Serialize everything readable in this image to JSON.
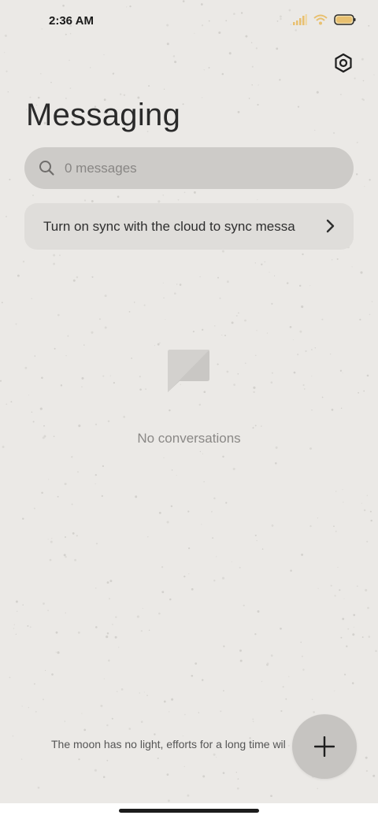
{
  "status_bar": {
    "time": "2:36 AM",
    "icons": [
      "signal-icon",
      "wifi-icon",
      "battery-icon"
    ],
    "signal_color": "#e8c070",
    "wifi_color": "#e8c070",
    "battery_color": "#e8c070"
  },
  "header": {
    "title": "Messaging",
    "settings_icon": "settings-icon"
  },
  "search": {
    "icon": "search-icon",
    "placeholder": "0 messages"
  },
  "sync_banner": {
    "text": "Turn on sync with the cloud to sync messa",
    "icon": "chevron-right-icon"
  },
  "empty_state": {
    "icon": "message-bubble-icon",
    "text": "No conversations"
  },
  "footer": {
    "motto": "The moon has no light, efforts for a long time wil"
  },
  "fab": {
    "icon": "plus-icon"
  },
  "colors": {
    "background": "#ebe9e6",
    "search_bg": "#cdcbc8",
    "banner_bg": "#dfddda",
    "fab_bg": "#c6c4c1"
  }
}
